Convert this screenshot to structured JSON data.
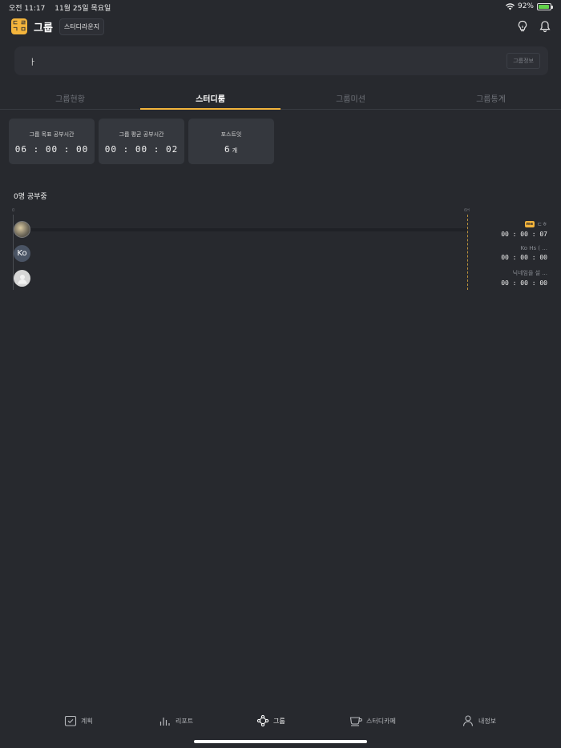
{
  "status_bar": {
    "time": "오전 11:17",
    "date": "11월 25일 목요일",
    "battery": "92%",
    "battery_level": 0.92,
    "battery_color": "#62d24a"
  },
  "header": {
    "logo_text": "ㄷㄱ\nㄹㅁ",
    "title": "그룹",
    "lounge_button": "스터디라운지"
  },
  "notice": {
    "text": "ㅏ",
    "info_button": "그룹정보"
  },
  "tabs": [
    {
      "label": "그룹현황",
      "active": false
    },
    {
      "label": "스터디룸",
      "active": true
    },
    {
      "label": "그룹미션",
      "active": false
    },
    {
      "label": "그룹통계",
      "active": false
    }
  ],
  "stats": [
    {
      "label": "그룹 목표 공부시간",
      "value": "06 : 00 : 00",
      "unit": ""
    },
    {
      "label": "그룹 평균 공부시간",
      "value": "00 : 00 : 02",
      "unit": ""
    },
    {
      "label": "포스트잇",
      "value": "6",
      "unit": "개"
    }
  ],
  "studying": {
    "count_label": "0명 공부중",
    "axis_start": "0",
    "axis_end": "6H",
    "members": [
      {
        "avatar_text": "",
        "me_badge": "me",
        "name": "ㄷㅎ",
        "time": "00 : 00 : 07"
      },
      {
        "avatar_text": "Ko",
        "me_badge": "",
        "name": "Ko Hs ( ...",
        "time": "00 : 00 : 00"
      },
      {
        "avatar_text": "",
        "me_badge": "",
        "name": "닉네임을 설 ...",
        "time": "00 : 00 : 00"
      }
    ]
  },
  "bottom_nav": [
    {
      "label": "계획",
      "icon": "calendar-check-icon",
      "active": false
    },
    {
      "label": "리포트",
      "icon": "bar-chart-icon",
      "active": false
    },
    {
      "label": "그룹",
      "icon": "group-network-icon",
      "active": true
    },
    {
      "label": "스터디카페",
      "icon": "coffee-cup-icon",
      "active": false
    },
    {
      "label": "내정보",
      "icon": "person-icon",
      "active": false
    }
  ],
  "colors": {
    "accent": "#f3b43c",
    "background": "#27292e",
    "card": "#35383e"
  }
}
